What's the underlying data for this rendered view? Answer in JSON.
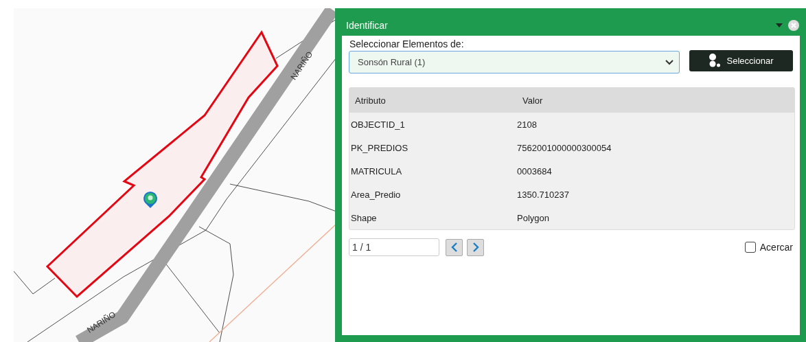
{
  "map": {
    "road_labels": [
      "NARIÑO",
      "NARIÑO"
    ]
  },
  "dialog": {
    "title": "Identificar",
    "select_label": "Seleccionar Elementos de:",
    "layer_select": {
      "value": "Sonsón Rural (1)"
    },
    "select_button": "Seleccionar",
    "table": {
      "columns": [
        "Atributo",
        "Valor"
      ],
      "rows": [
        {
          "attribute": "OBJECTID_1",
          "value": "2108"
        },
        {
          "attribute": "PK_PREDIOS",
          "value": "7562001000000300054"
        },
        {
          "attribute": "MATRICULA",
          "value": "0003684"
        },
        {
          "attribute": "Area_Predio",
          "value": "1350.710237"
        },
        {
          "attribute": "Shape",
          "value": "Polygon"
        }
      ]
    },
    "pager": {
      "value": "1 / 1"
    },
    "zoom_checkbox": {
      "label": "Acercar",
      "checked": false
    }
  }
}
